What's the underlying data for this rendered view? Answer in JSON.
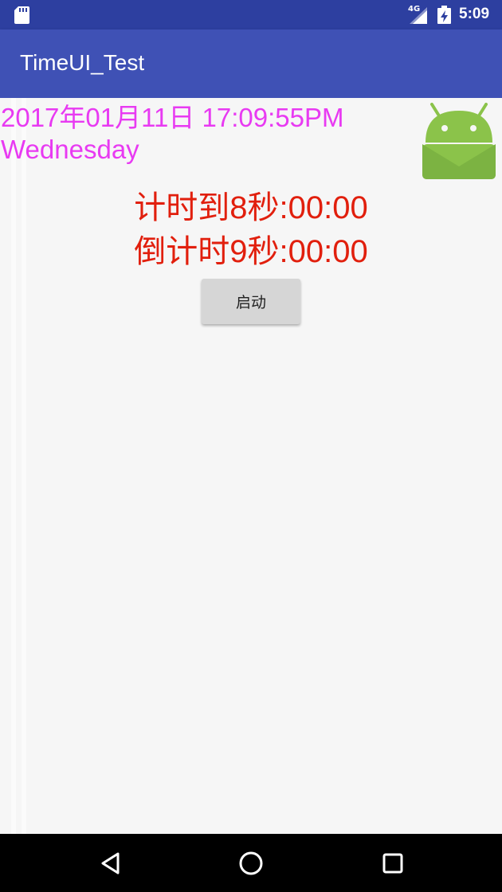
{
  "status_bar": {
    "network_type": "4G",
    "time": "5:09",
    "icons": [
      "sd-card-icon",
      "signal-icon",
      "battery-charging-icon"
    ]
  },
  "app_bar": {
    "title": "TimeUI_Test"
  },
  "main": {
    "date_time": "2017年01月11日 17:09:55PM",
    "weekday": "Wednesday",
    "count_up": "计时到8秒:00:00",
    "count_down": "倒计时9秒:00:00",
    "start_button_label": "启动",
    "image_icon": "android-robot-icon"
  },
  "nav_bar": {
    "icons": [
      "back-icon",
      "home-icon",
      "recents-icon"
    ]
  },
  "colors": {
    "status_bar": "#2d3fa0",
    "app_bar": "#3f51b5",
    "date_text": "#e83af2",
    "timer_text": "#e11f0d",
    "button": "#d6d6d6",
    "android_green": "#8bc34a"
  }
}
